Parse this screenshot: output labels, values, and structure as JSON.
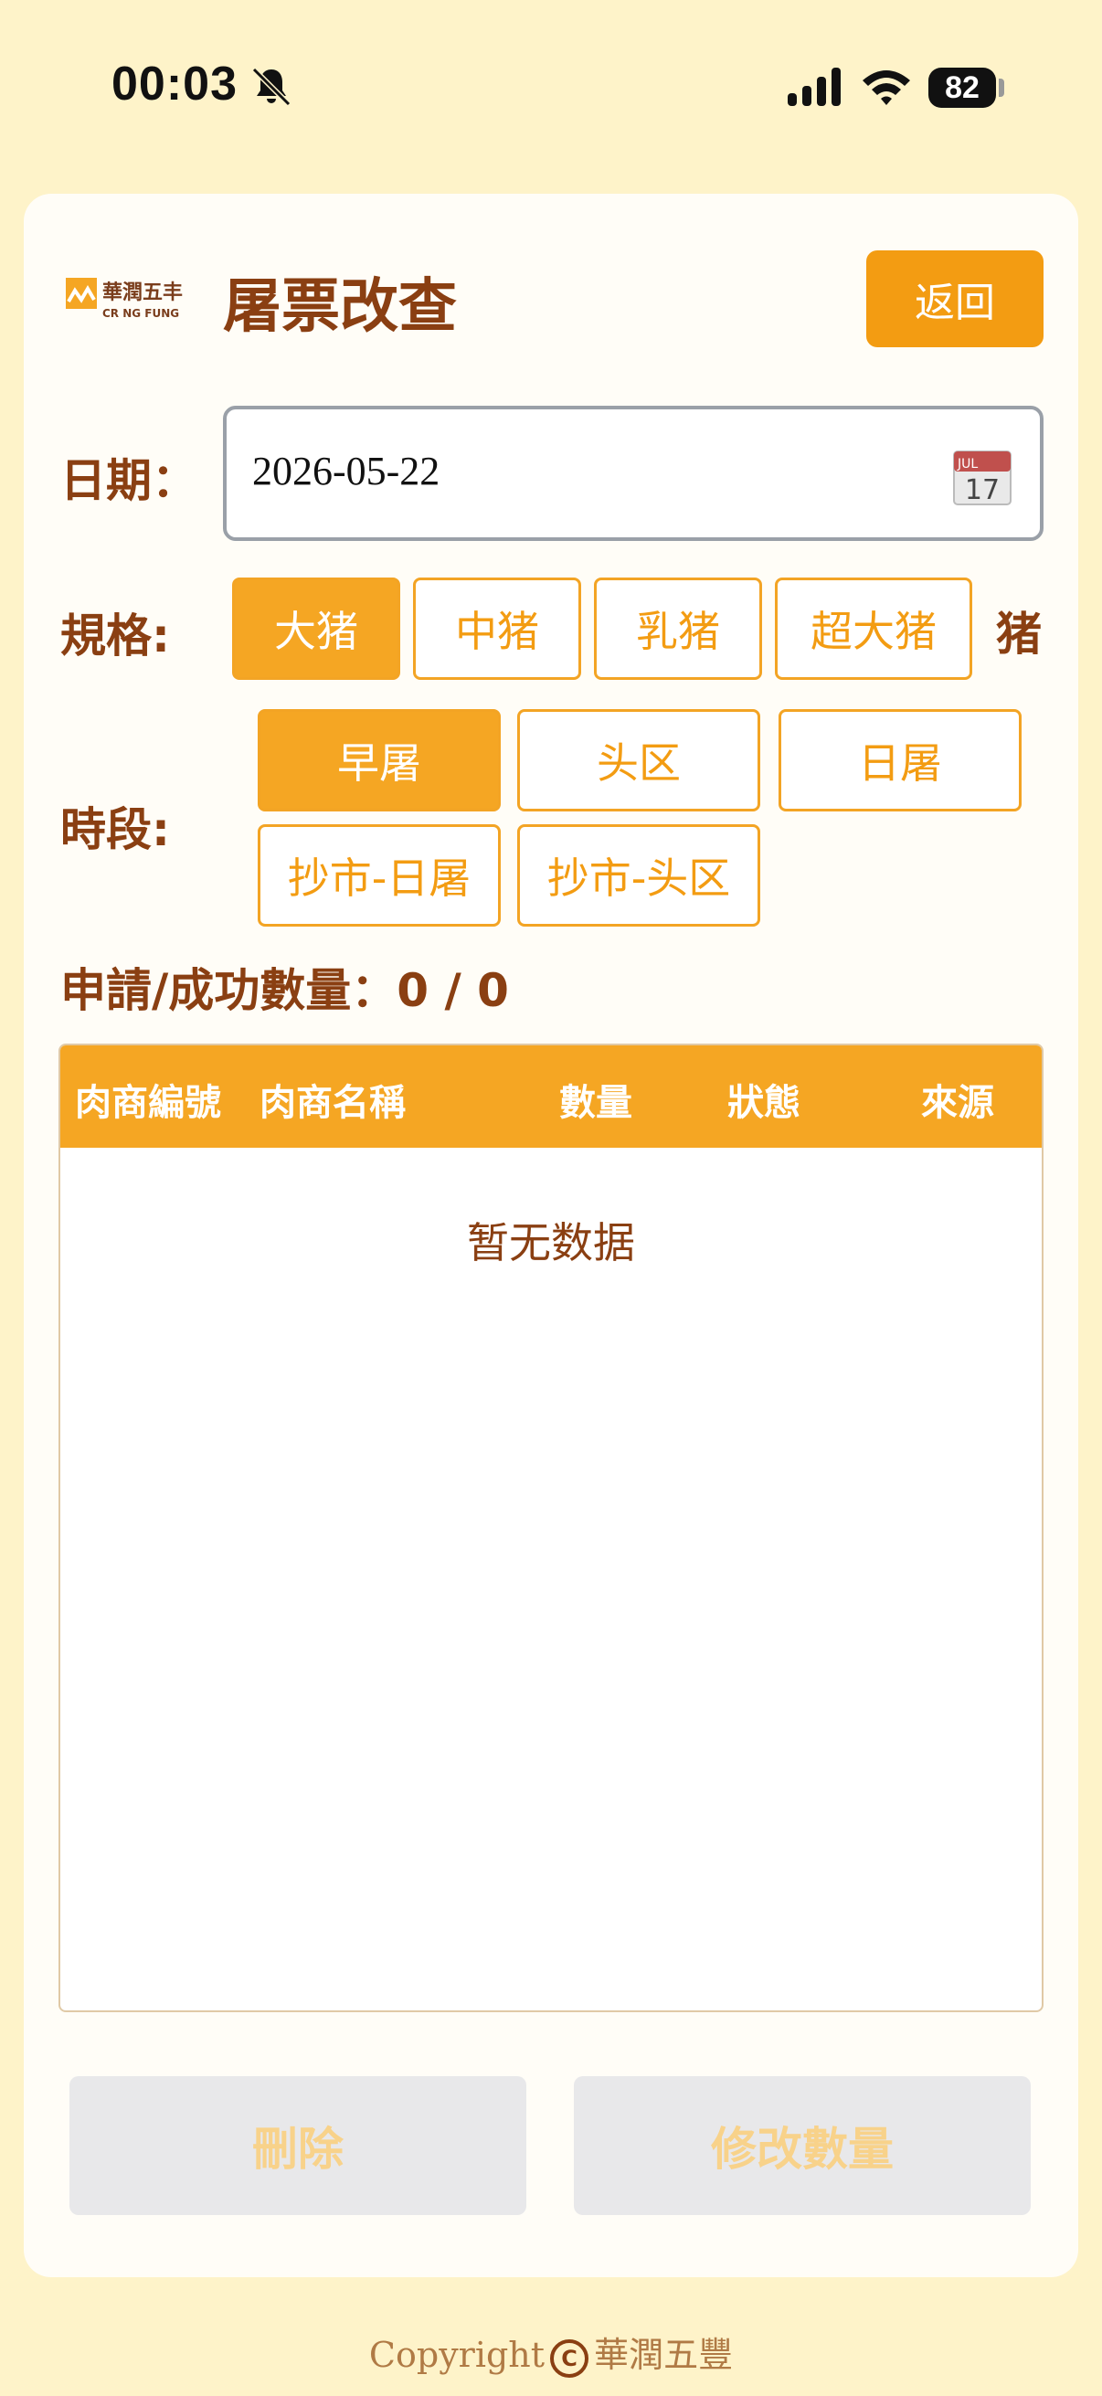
{
  "status_bar": {
    "time": "00:03",
    "battery": "82"
  },
  "header": {
    "logo_text": "華潤五丰",
    "logo_subtext": "CR NG FUNG",
    "title": "屠票改查",
    "back_label": "返回"
  },
  "date": {
    "label": "日期：",
    "value": "2026-05-22",
    "calendar_month": "JUL",
    "calendar_day": "17"
  },
  "spec": {
    "label": "規格:",
    "options": [
      "大猪",
      "中猪",
      "乳猪",
      "超大猪"
    ],
    "selected_index": 0,
    "suffix": "猪"
  },
  "period": {
    "label": "時段:",
    "options": [
      "早屠",
      "头区",
      "日屠",
      "抄市-日屠",
      "抄市-头区"
    ],
    "selected_index": 0
  },
  "summary": {
    "text": "申請/成功數量：0 / 0"
  },
  "table": {
    "columns": [
      "肉商編號",
      "肉商名稱",
      "數量",
      "狀態",
      "來源"
    ],
    "rows": [],
    "empty_text": "暂无数据"
  },
  "actions": {
    "delete_label": "刪除",
    "modify_label": "修改數量"
  },
  "footer": {
    "copyright": "Copyright",
    "brand": "華潤五豐"
  },
  "colors": {
    "accent": "#f5a623",
    "title": "#8a3f12",
    "background": "#fef3c9"
  }
}
